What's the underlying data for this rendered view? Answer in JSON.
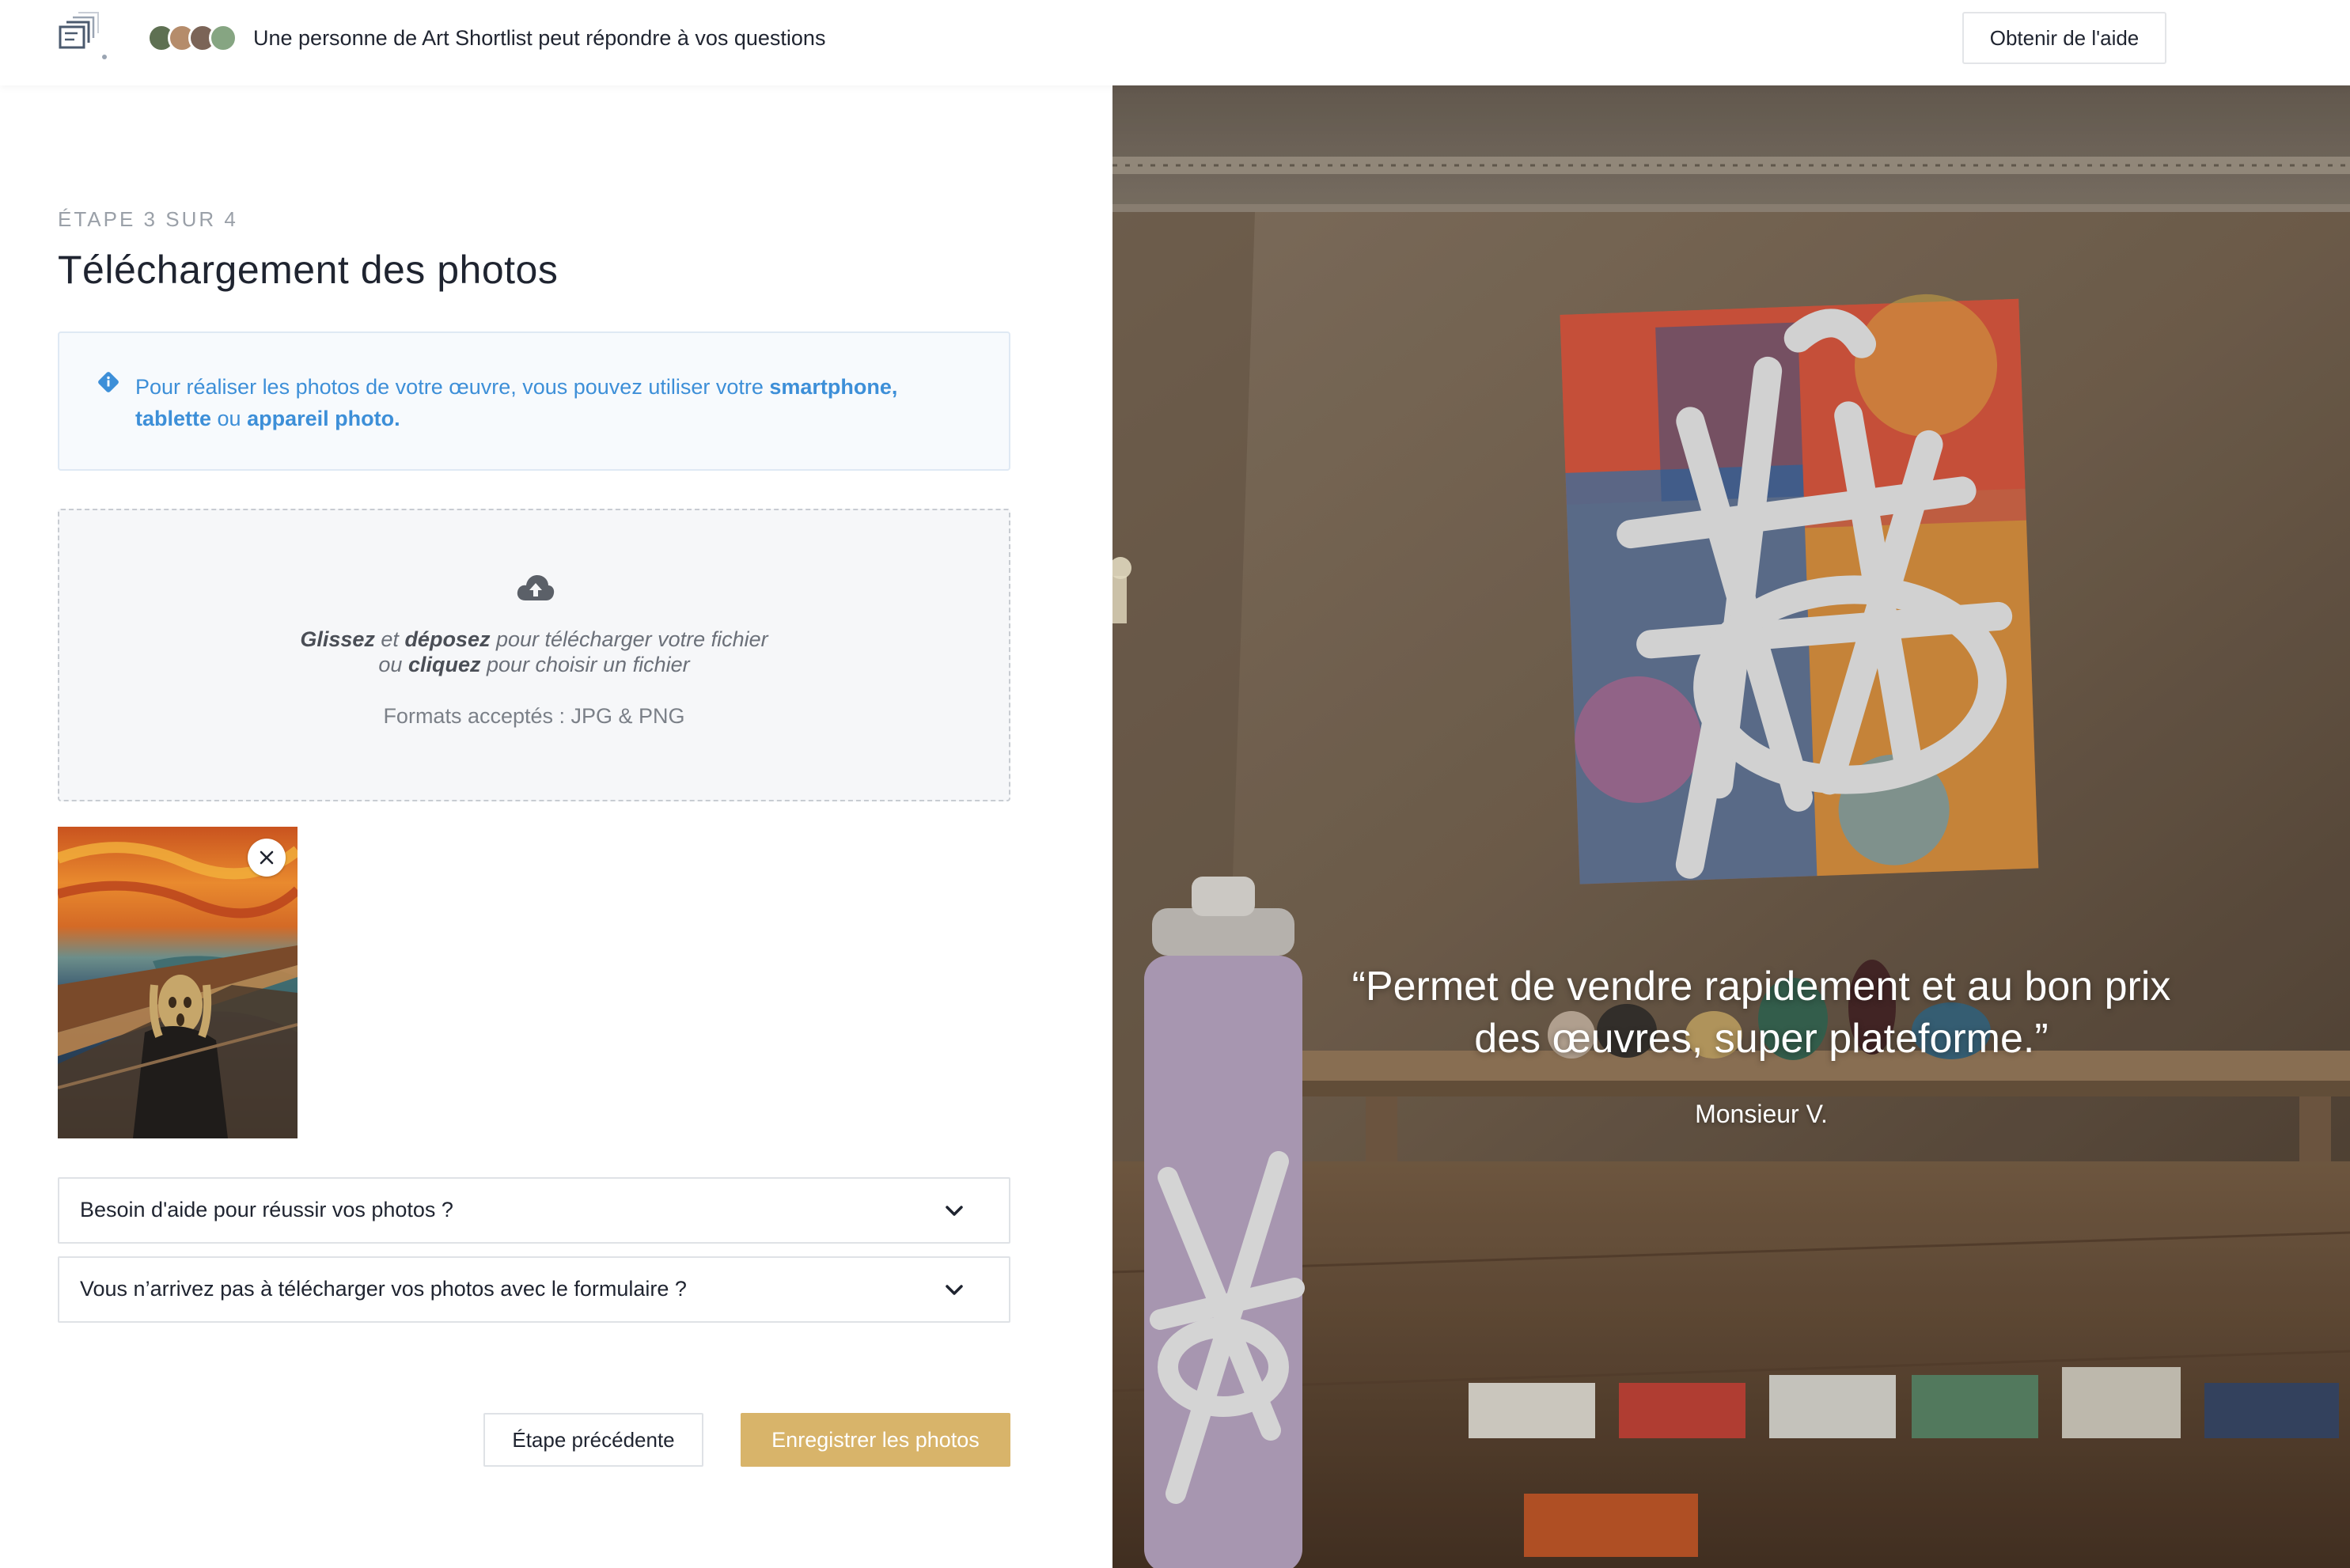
{
  "header": {
    "support_text": "Une personne de Art Shortlist peut répondre à vos questions",
    "help_button": "Obtenir de l'aide",
    "logo_icon": "stacked-frames-icon",
    "avatars": [
      "#6a7b5c",
      "#b08a6a",
      "#8a7060",
      "#7a9a78"
    ]
  },
  "form": {
    "step_label": "ÉTAPE 3 SUR 4",
    "title": "Téléchargement des photos",
    "info": {
      "icon": "info-diamond-icon",
      "part1": "Pour réaliser les photos de votre œuvre, vous pouvez utiliser votre ",
      "bold1": "smartphone,",
      "bold2": "tablette",
      "part2": " ou ",
      "bold3": "appareil photo."
    },
    "dropzone": {
      "icon": "cloud-upload-icon",
      "drag": "Glissez",
      "and": " et ",
      "drop": "déposez",
      "line1_rest": " pour télécharger votre fichier",
      "or": "ou ",
      "click": "cliquez",
      "line2_rest": " pour choisir un fichier",
      "formats": "Formats acceptés : JPG & PNG"
    },
    "uploaded": {
      "remove_icon": "close-icon"
    },
    "accordions": [
      {
        "label": "Besoin d'aide pour réussir vos photos ?"
      },
      {
        "label": "Vous n’arrivez pas à télécharger vos photos avec le formulaire ?"
      }
    ],
    "prev_button": "Étape précédente",
    "save_button": "Enregistrer les photos"
  },
  "testimonial": {
    "quote_line1": "“Permet de vendre rapidement et au bon prix",
    "quote_line2": "des œuvres, super plateforme.”",
    "author": "Monsieur V."
  },
  "colors": {
    "accent_gold": "#d8b46a",
    "info_blue": "#3d8fd8"
  }
}
